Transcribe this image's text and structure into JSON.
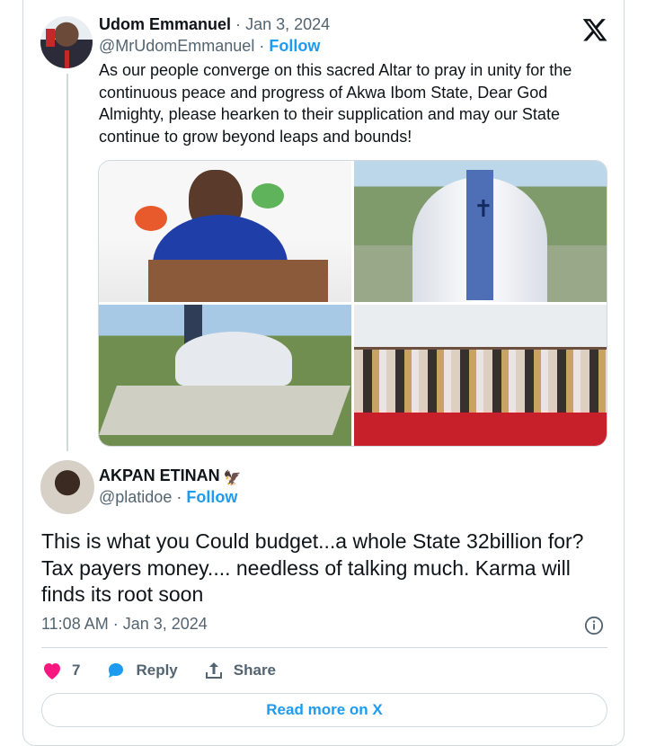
{
  "quoted_tweet": {
    "author_name": "Udom Emmanuel",
    "separator": "·",
    "date": "Jan 3, 2024",
    "handle": "@MrUdomEmmanuel",
    "follow_label": "Follow",
    "text": "As our people converge on this sacred Altar to pray in unity for the continuous peace and progress of Akwa Ibom State, Dear God Almighty, please hearken to their supplication and may our State continue to grow beyond leaps and bounds!",
    "photos": [
      "speaker-at-podium-photo",
      "cathedral-aerial-photo",
      "cathedral-wide-aerial-photo",
      "congregation-group-photo"
    ]
  },
  "reply": {
    "author_name": "AKPAN ETINAN",
    "badge_icon": "eagle-icon",
    "handle": "@platidoe",
    "follow_label": "Follow",
    "text": "This is what you Could budget...a whole State 32billion for? Tax payers money.... needless of talking much. Karma will finds its root soon",
    "timestamp": "11:08 AM · Jan 3, 2024"
  },
  "actions": {
    "like_count": "7",
    "reply_label": "Reply",
    "share_label": "Share"
  },
  "read_more_label": "Read more on X",
  "colors": {
    "accent": "#1d9bf0",
    "like": "#f91880",
    "muted": "#536471",
    "border": "#cfd9de"
  }
}
